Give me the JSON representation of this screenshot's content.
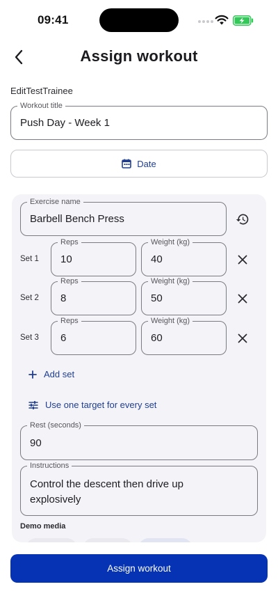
{
  "status_bar": {
    "time": "09:41"
  },
  "header": {
    "title": "Assign workout"
  },
  "trainee_name": "EditTestTrainee",
  "workout_title": {
    "label": "Workout title",
    "value": "Push Day - Week 1"
  },
  "date_button": {
    "label": "Date"
  },
  "exercise": {
    "name_label": "Exercise name",
    "name_value": "Barbell Bench Press",
    "reps_label": "Reps",
    "weight_label": "Weight (kg)",
    "sets": [
      {
        "label": "Set 1",
        "reps": "10",
        "weight": "40"
      },
      {
        "label": "Set 2",
        "reps": "8",
        "weight": "50"
      },
      {
        "label": "Set 3",
        "reps": "6",
        "weight": "60"
      }
    ],
    "add_set_label": "Add set",
    "one_target_label": "Use one target for every set",
    "rest_label": "Rest (seconds)",
    "rest_value": "90",
    "instructions_label": "Instructions",
    "instructions_line1": "Control the descent then drive up",
    "instructions_line2": "explosively",
    "demo_media_label": "Demo media"
  },
  "assign_button": {
    "label": "Assign workout"
  },
  "colors": {
    "accent": "#0633b4",
    "link": "#1f3d91",
    "card_bg": "#f4f4f8",
    "battery": "#34c759"
  }
}
